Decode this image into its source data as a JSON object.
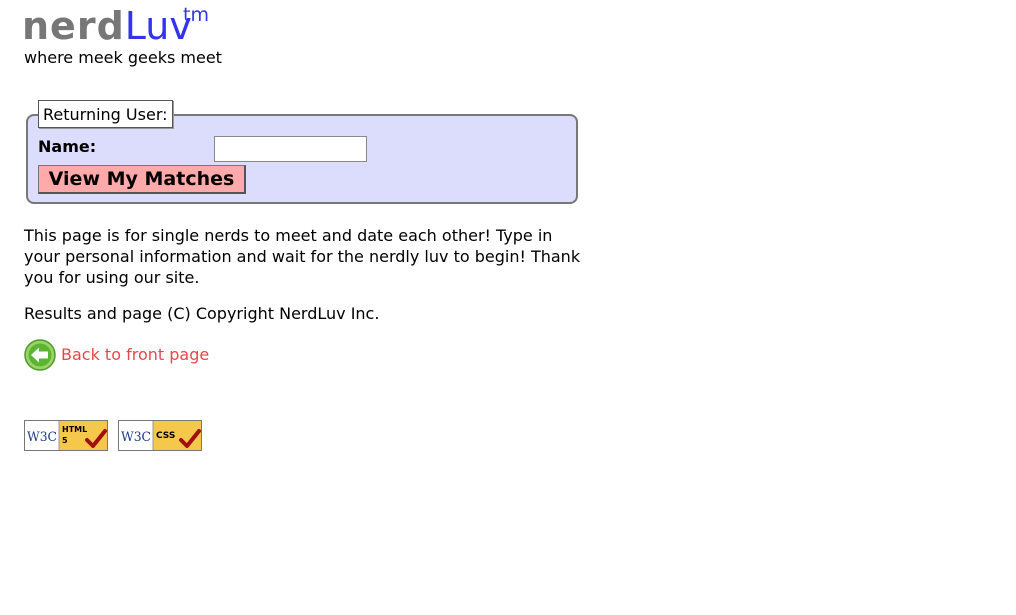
{
  "header": {
    "logo_nerd": "nerd",
    "logo_luv": "Luv",
    "logo_tm": "tm",
    "tagline": "where meek geeks meet"
  },
  "login_form": {
    "legend": "Returning User:",
    "name_label": "Name:",
    "name_value": "",
    "submit_label": "View My Matches"
  },
  "content": {
    "intro": "This page is for single nerds to meet and date each other! Type in your personal information and wait for the nerdly luv to begin! Thank you for using our site.",
    "copyright": "Results and page (C) Copyright NerdLuv Inc."
  },
  "back_link": {
    "label": "Back to front page",
    "icon": "back-arrow-icon"
  },
  "badges": [
    {
      "name": "w3c-html5-badge",
      "w3c": "W3C",
      "line1": "HTML",
      "line2": "5"
    },
    {
      "name": "w3c-css-badge",
      "w3c": "W3C",
      "line1": "CSS",
      "line2": ""
    }
  ],
  "colors": {
    "logo_gray": "#777777",
    "logo_blue": "#3333ee",
    "fieldset_bg": "#dcdcfd",
    "button_bg": "#ffaaaa",
    "link_red": "#e8474a",
    "badge_gold": "#f5c84c",
    "check_red": "#a01010"
  }
}
